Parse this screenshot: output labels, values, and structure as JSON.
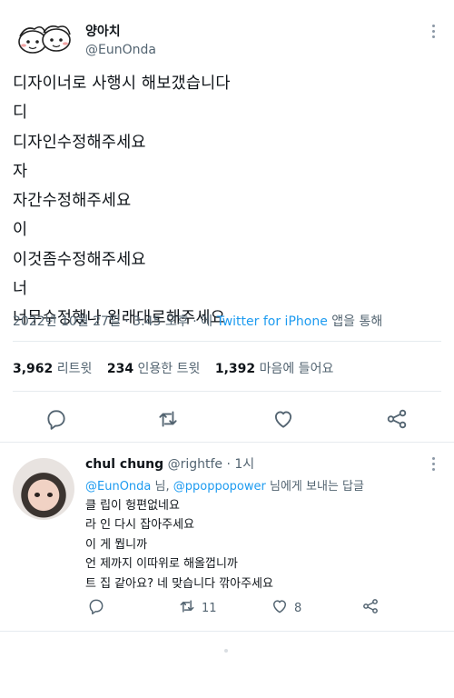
{
  "tweet": {
    "author_name": "양아치",
    "author_handle": "@EunOnda",
    "lines": [
      "디자이너로 사행시 해보갰습니다",
      "디",
      "디자인수정해주세요",
      "자",
      "자간수정해주세요",
      "이",
      "이것좀수정해주세요",
      "너",
      "너무수정했나 원래대로해주세요"
    ],
    "meta_time": "2022년 10월 27일 · 3:45 오후 · 에 ",
    "meta_source": "Twitter for iPhone",
    "meta_suffix": " 앱을 통해",
    "stats": {
      "retweets_count": "3,962",
      "retweets_label": "리트윗",
      "quotes_count": "234",
      "quotes_label": "인용한 트윗",
      "likes_count": "1,392",
      "likes_label": "마음에 들어요"
    },
    "actions": [
      "reply-icon",
      "retweet-icon",
      "like-icon",
      "share-icon"
    ]
  },
  "reply": {
    "name": "chul chung",
    "handle": "@rightfe",
    "time": " · 1시",
    "reply_to_prefix": "",
    "reply_to_user1": "@EunOnda",
    "reply_to_mid": " 님, ",
    "reply_to_user2": "@ppoppopower",
    "reply_to_suffix": " 님에게 보내는 답글",
    "lines": [
      "클 립이 헝편없네요",
      "라 인 다시 잡아주세요",
      "이 게 뭡니까",
      "언 제까지 이따위로 해올껍니까",
      "트 집 같아요? 네 맞습니다 깎아주세요"
    ],
    "retweet_count": "11",
    "like_count": "8"
  },
  "colors": {
    "accent": "#1d9bf0",
    "text": "#0f1419",
    "muted": "#536471",
    "divider": "#e6ebef"
  }
}
